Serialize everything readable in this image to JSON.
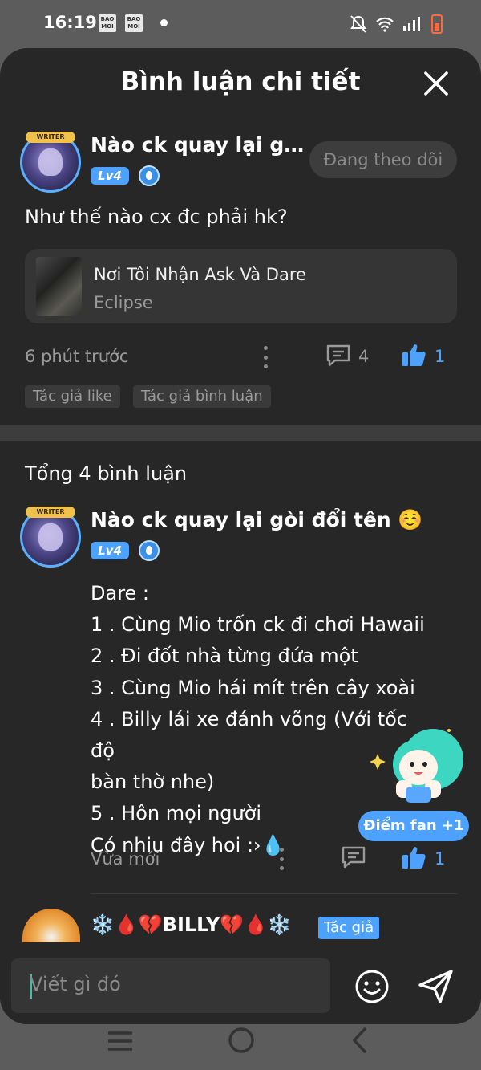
{
  "status_bar": {
    "time": "16:19",
    "app_badge_text": "BAO MOI"
  },
  "header": {
    "title": "Bình luận chi tiết",
    "close_icon": "close-icon"
  },
  "post": {
    "author": "Nào ck quay lại gòi đổi tên ☺️",
    "level": "Lv4",
    "avatar_badge": "WRITER",
    "follow_label": "Đang theo dõi",
    "text": "Như thế nào cx đc phải hk?",
    "link": {
      "title": "Nơi Tôi Nhận Ask Và Dare",
      "subtitle": "Eclipse"
    },
    "time": "6 phút trước",
    "comments": "4",
    "likes": "1",
    "tags": [
      "Tác giả like",
      "Tác giả bình luận"
    ]
  },
  "comments_section": {
    "total_label": "Tổng 4 bình luận",
    "comment": {
      "author": "Nào ck quay lại gòi đổi tên ☺️",
      "level": "Lv4",
      "avatar_badge": "WRITER",
      "lines": [
        "Dare :",
        "1 . Cùng Mio trốn ck đi chơi Hawaii",
        "2 . Đi đốt nhà từng đứa một",
        "3 . Cùng Mio hái mít trên cây xoài",
        "4 . Billy lái xe đánh võng (Với tốc độ",
        "bàn thờ nhe)",
        "5 . Hôn mọi người",
        "Có nhiu đây hoi :›💧"
      ],
      "time": "Vừa mới",
      "likes": "1"
    },
    "fan_points": "Điểm fan +1",
    "reply": {
      "author": "❄️🩸💔BILLY💔🩸❄️",
      "badge": "Tác giả"
    }
  },
  "composer": {
    "placeholder": "Viết gì đó"
  },
  "colors": {
    "accent": "#4da1ff",
    "background": "#272727",
    "card": "#353535"
  }
}
